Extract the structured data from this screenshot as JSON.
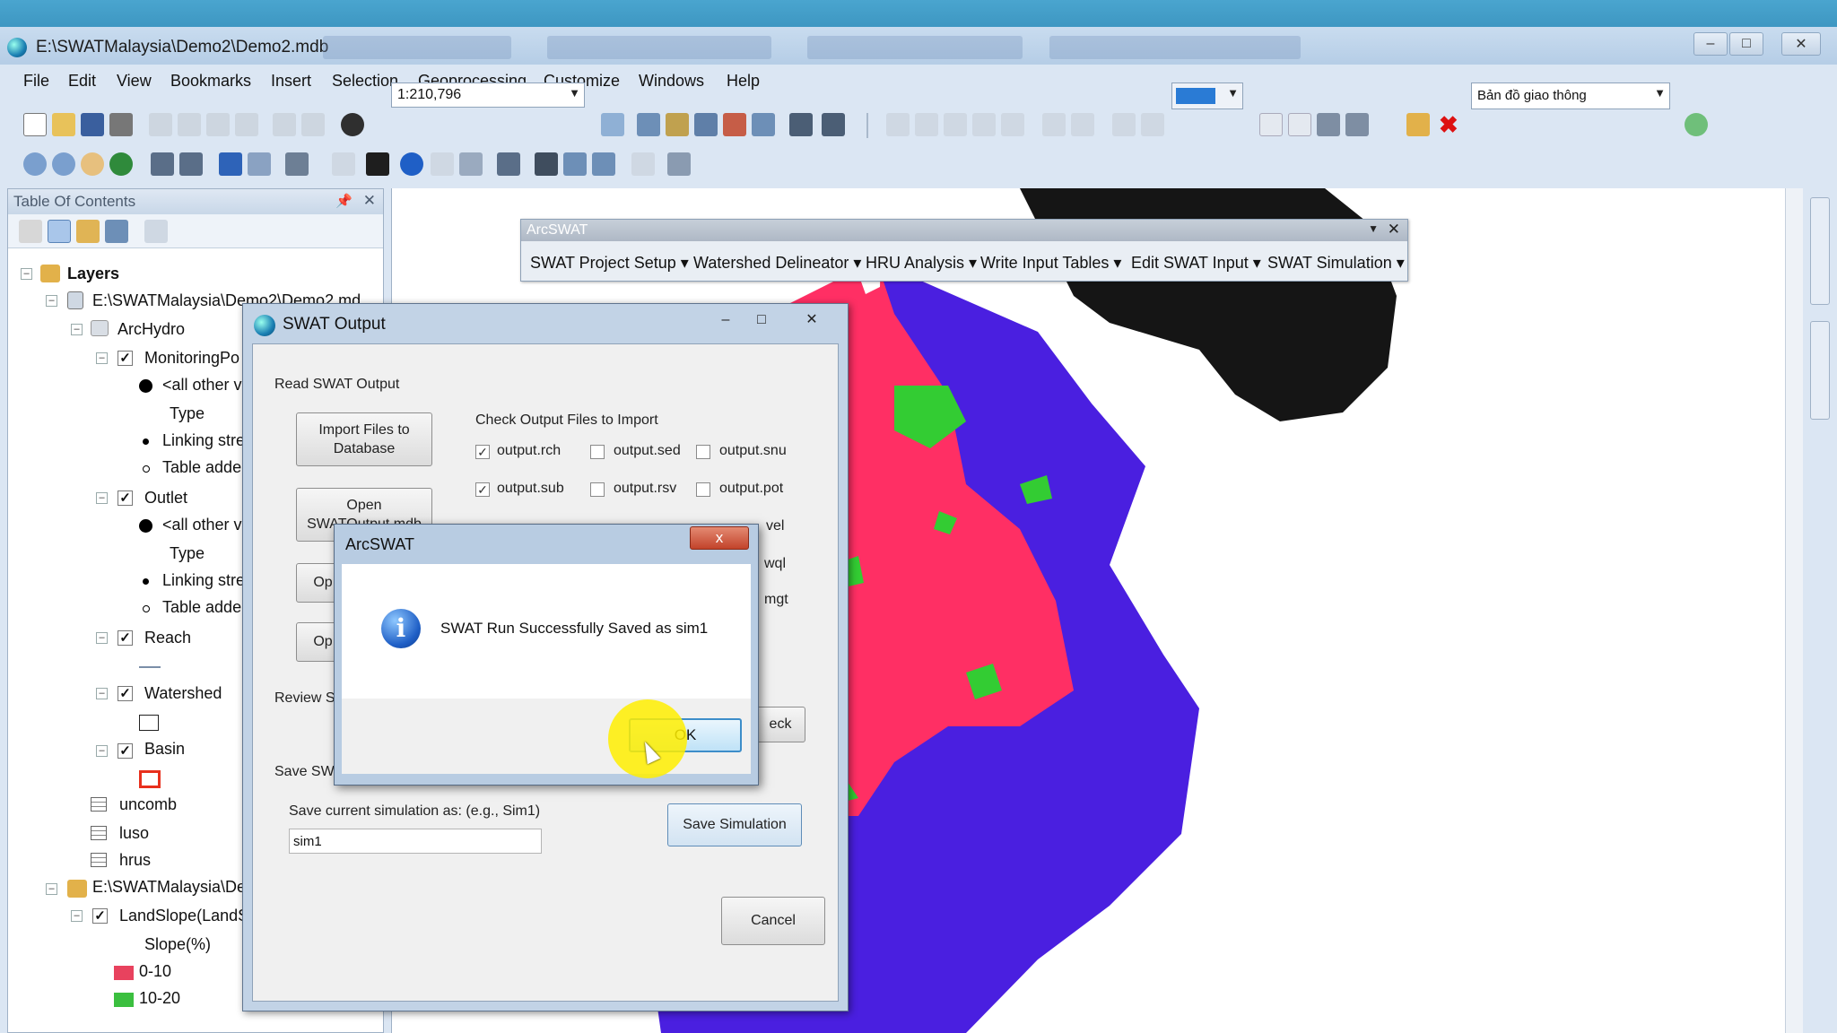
{
  "window": {
    "title": "E:\\SWATMalaysia\\Demo2\\Demo2.mdb"
  },
  "menu": [
    "File",
    "Edit",
    "View",
    "Bookmarks",
    "Insert",
    "Selection",
    "Geoprocessing",
    "Customize",
    "Windows",
    "Help"
  ],
  "toolbar": {
    "scale": "1:210,796",
    "layer_combo": "Bản đồ giao thông"
  },
  "toc": {
    "title": "Table Of Contents",
    "rows": [
      "Layers",
      "E:\\SWATMalaysia\\Demo2\\Demo2.md",
      "ArcHydro",
      "MonitoringPo",
      "<all other v",
      "Type",
      "Linking stre",
      "Table adde",
      "Outlet",
      "<all other v",
      "Type",
      "Linking stre",
      "Table adde",
      "Reach",
      "Watershed",
      "Basin",
      "uncomb",
      "luso",
      "hrus",
      "E:\\SWATMalaysia\\De",
      "LandSlope(LandS",
      "Slope(%)",
      "0-10",
      "10-20"
    ],
    "legend_colors": {
      "slope_0_10": "#e8425e",
      "slope_10_20": "#3bbf3f",
      "basin": "#e8301d"
    }
  },
  "arcswat_toolbar": {
    "title": "ArcSWAT",
    "menus": [
      "SWAT Project Setup",
      "Watershed Delineator",
      "HRU Analysis",
      "Write Input Tables",
      "Edit SWAT Input",
      "SWAT Simulation"
    ]
  },
  "swat_output": {
    "title": "SWAT Output",
    "section_read": "Read SWAT Output",
    "import_btn": "Import Files to Database",
    "open_btn_1": "Open SWATOutput.mdb",
    "open_btn_2_partial": "Op",
    "open_btn_3_partial": "Op",
    "check_label": "Check Output Files to Import",
    "files": [
      {
        "name": "output.rch",
        "checked": true
      },
      {
        "name": "output.sed",
        "checked": false
      },
      {
        "name": "output.snu",
        "checked": false
      },
      {
        "name": "output.sub",
        "checked": true
      },
      {
        "name": "output.rsv",
        "checked": false
      },
      {
        "name": "output.pot",
        "checked": false
      }
    ],
    "partial_labels": [
      "vel",
      "wql",
      "mgt"
    ],
    "review_label": "Review S",
    "check_btn_partial": "eck",
    "save_label": "Save SW",
    "save_prompt": "Save current simulation as: (e.g., Sim1)",
    "sim_value": "sim1",
    "save_btn": "Save Simulation",
    "cancel_btn": "Cancel"
  },
  "dialog": {
    "title": "ArcSWAT",
    "close": "x",
    "message": "SWAT Run Successfully Saved as sim1",
    "ok": "OK"
  },
  "map_colors": {
    "pink": "#ff2f64",
    "blue": "#4a1fe0",
    "green": "#33cc33",
    "dark": "#151515"
  }
}
